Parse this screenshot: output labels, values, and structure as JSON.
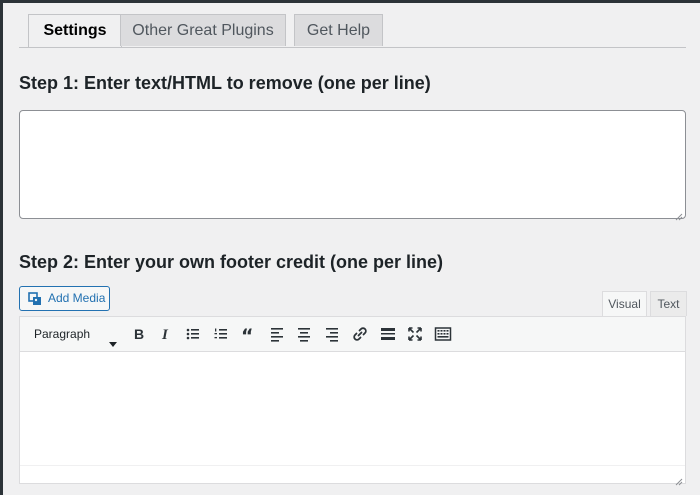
{
  "tabs": [
    {
      "label": "Settings",
      "active": true
    },
    {
      "label": "Other Great Plugins",
      "active": false
    },
    {
      "label": "Get Help",
      "active": false
    }
  ],
  "step1": {
    "heading": "Step 1: Enter text/HTML to remove (one per line)",
    "value": ""
  },
  "step2": {
    "heading": "Step 2: Enter your own footer credit (one per line)"
  },
  "editor": {
    "add_media_label": "Add Media",
    "mode_tabs": {
      "visual": "Visual",
      "text": "Text",
      "active": "visual"
    },
    "format_select": "Paragraph",
    "toolbar_icons": [
      "bold-icon",
      "italic-icon",
      "bulleted-list-icon",
      "numbered-list-icon",
      "blockquote-icon",
      "align-left-icon",
      "align-center-icon",
      "align-right-icon",
      "link-icon",
      "read-more-icon",
      "fullscreen-icon",
      "toolbar-toggle-icon"
    ],
    "content": ""
  },
  "colors": {
    "accent": "#2271b1",
    "background": "#f0f0f1",
    "text": "#1d2327"
  }
}
